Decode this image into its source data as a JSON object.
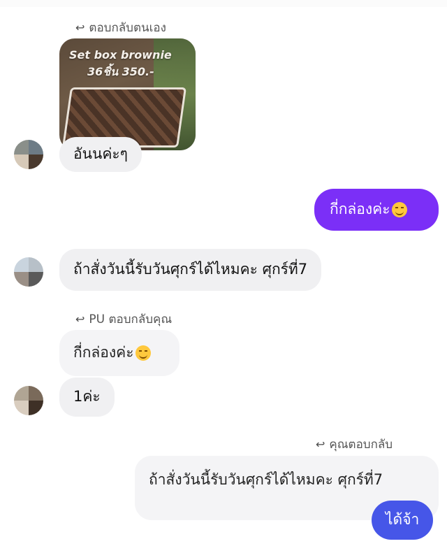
{
  "messages": [
    {
      "reply_hint": "ตอบกลับตนเอง"
    },
    {
      "image_caption_line1": "Set box brownie",
      "image_caption_line2": "36ชิ้น 350.-"
    },
    {
      "text": "อันนค่ะๆ"
    },
    {
      "text": "กี่กล่องค่ะ"
    },
    {
      "text": "ถ้าสั่งวันนี้รับวันศุกร์ได้ไหมคะ ศุกร์ที่7"
    },
    {
      "reply_hint": "PU ตอบกลับคุณ"
    },
    {
      "quoted_text": "กี่กล่องค่ะ"
    },
    {
      "text": "1ค่ะ"
    },
    {
      "reply_hint": "คุณตอบกลับ"
    },
    {
      "quoted_text": "ถ้าสั่งวันนี้รับวันศุกร์ได้ไหมคะ ศุกร์ที่7"
    },
    {
      "text": "ได้จ้า"
    }
  ],
  "colors": {
    "outgoing_bubble": "#7b2ff7",
    "outgoing_bubble_reply": "#4656e8",
    "incoming_bubble": "#f0f0f2",
    "reply_hint_text": "#555555"
  },
  "icons": {
    "reply": "reply-arrow-icon",
    "emoji": "smiling-face-icon"
  }
}
